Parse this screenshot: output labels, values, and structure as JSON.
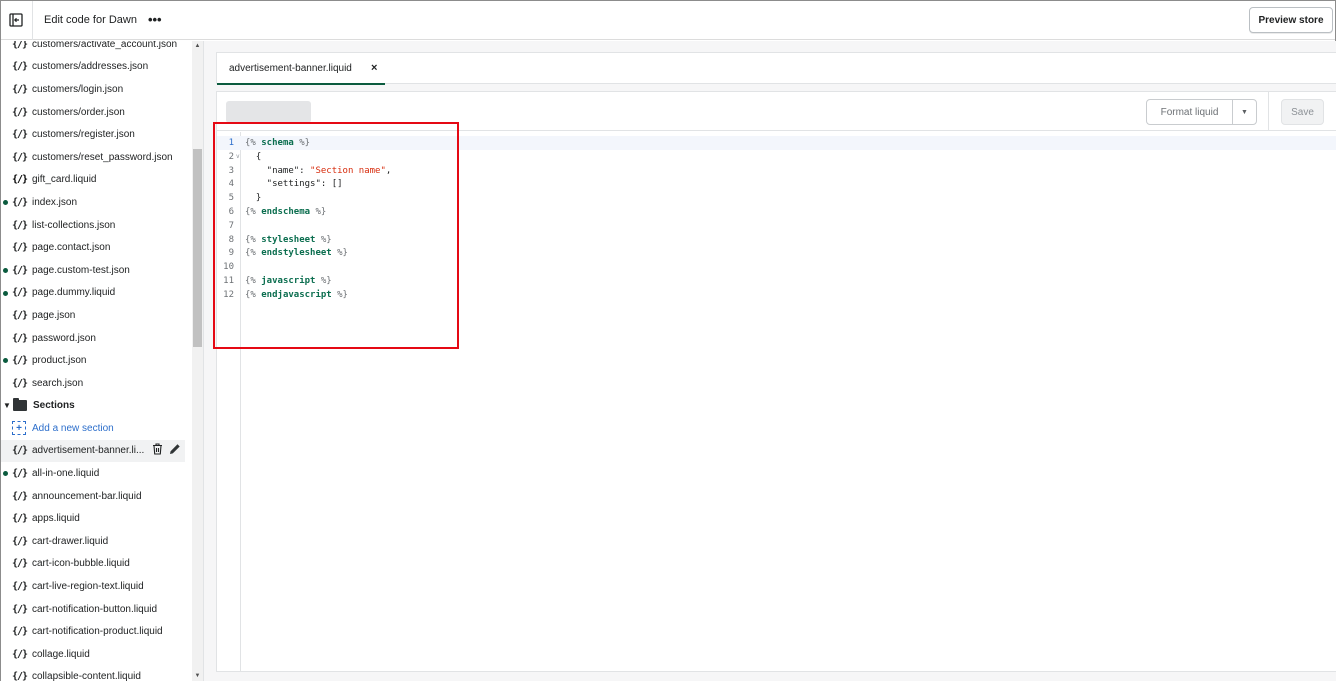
{
  "topbar": {
    "title": "Edit code for Dawn",
    "more": "•••",
    "preview_label": "Preview store"
  },
  "sidebar": {
    "files_top": [
      {
        "name": "customers/activate_account.json",
        "dot": false,
        "bold": false
      },
      {
        "name": "customers/addresses.json",
        "dot": false,
        "bold": false
      },
      {
        "name": "customers/login.json",
        "dot": false,
        "bold": false
      },
      {
        "name": "customers/order.json",
        "dot": false,
        "bold": false
      },
      {
        "name": "customers/register.json",
        "dot": false,
        "bold": false
      },
      {
        "name": "customers/reset_password.json",
        "dot": false,
        "bold": false
      },
      {
        "name": "gift_card.liquid",
        "dot": false,
        "bold": true
      },
      {
        "name": "index.json",
        "dot": true,
        "bold": false
      },
      {
        "name": "list-collections.json",
        "dot": false,
        "bold": false
      },
      {
        "name": "page.contact.json",
        "dot": false,
        "bold": false
      },
      {
        "name": "page.custom-test.json",
        "dot": true,
        "bold": false
      },
      {
        "name": "page.dummy.liquid",
        "dot": true,
        "bold": false
      },
      {
        "name": "page.json",
        "dot": false,
        "bold": false
      },
      {
        "name": "password.json",
        "dot": false,
        "bold": false
      },
      {
        "name": "product.json",
        "dot": true,
        "bold": false
      },
      {
        "name": "search.json",
        "dot": false,
        "bold": false
      }
    ],
    "sections_label": "Sections",
    "add_section_label": "Add a new section",
    "selected_file": "advertisement-banner.li...",
    "files_sections": [
      {
        "name": "all-in-one.liquid",
        "dot": true
      },
      {
        "name": "announcement-bar.liquid",
        "dot": false
      },
      {
        "name": "apps.liquid",
        "dot": false
      },
      {
        "name": "cart-drawer.liquid",
        "dot": false
      },
      {
        "name": "cart-icon-bubble.liquid",
        "dot": false
      },
      {
        "name": "cart-live-region-text.liquid",
        "dot": false
      },
      {
        "name": "cart-notification-button.liquid",
        "dot": false
      },
      {
        "name": "cart-notification-product.liquid",
        "dot": false
      },
      {
        "name": "collage.liquid",
        "dot": false
      },
      {
        "name": "collapsible-content.liquid",
        "dot": false
      }
    ],
    "file_icon": "{/}"
  },
  "editor": {
    "tab_label": "advertisement-banner.liquid",
    "tab_close": "×",
    "format_label": "Format liquid",
    "save_label": "Save",
    "lines": [
      {
        "n": "1",
        "parts": [
          [
            "delim",
            "{%"
          ],
          [
            "plain",
            " "
          ],
          [
            "kw",
            "schema"
          ],
          [
            "plain",
            " "
          ],
          [
            "delim",
            "%}"
          ]
        ]
      },
      {
        "n": "2",
        "fold": true,
        "parts": [
          [
            "plain",
            "  {"
          ]
        ]
      },
      {
        "n": "3",
        "parts": [
          [
            "plain",
            "    \"name\": "
          ],
          [
            "str",
            "\"Section name\""
          ],
          [
            "plain",
            ","
          ]
        ]
      },
      {
        "n": "4",
        "parts": [
          [
            "plain",
            "    \"settings\": []"
          ]
        ]
      },
      {
        "n": "5",
        "parts": [
          [
            "plain",
            "  }"
          ]
        ]
      },
      {
        "n": "6",
        "parts": [
          [
            "delim",
            "{%"
          ],
          [
            "plain",
            " "
          ],
          [
            "kw",
            "endschema"
          ],
          [
            "plain",
            " "
          ],
          [
            "delim",
            "%}"
          ]
        ]
      },
      {
        "n": "7",
        "parts": []
      },
      {
        "n": "8",
        "parts": [
          [
            "delim",
            "{%"
          ],
          [
            "plain",
            " "
          ],
          [
            "kw",
            "stylesheet"
          ],
          [
            "plain",
            " "
          ],
          [
            "delim",
            "%}"
          ]
        ]
      },
      {
        "n": "9",
        "parts": [
          [
            "delim",
            "{%"
          ],
          [
            "plain",
            " "
          ],
          [
            "kw",
            "endstylesheet"
          ],
          [
            "plain",
            " "
          ],
          [
            "delim",
            "%}"
          ]
        ]
      },
      {
        "n": "10",
        "parts": []
      },
      {
        "n": "11",
        "parts": [
          [
            "delim",
            "{%"
          ],
          [
            "plain",
            " "
          ],
          [
            "kw",
            "javascript"
          ],
          [
            "plain",
            " "
          ],
          [
            "delim",
            "%}"
          ]
        ]
      },
      {
        "n": "12",
        "parts": [
          [
            "delim",
            "{%"
          ],
          [
            "plain",
            " "
          ],
          [
            "kw",
            "endjavascript"
          ],
          [
            "plain",
            " "
          ],
          [
            "delim",
            "%}"
          ]
        ]
      }
    ]
  },
  "colors": {
    "accent_green": "#0b5b3e",
    "link_blue": "#2c6ecb",
    "highlight_red": "#e50914"
  }
}
